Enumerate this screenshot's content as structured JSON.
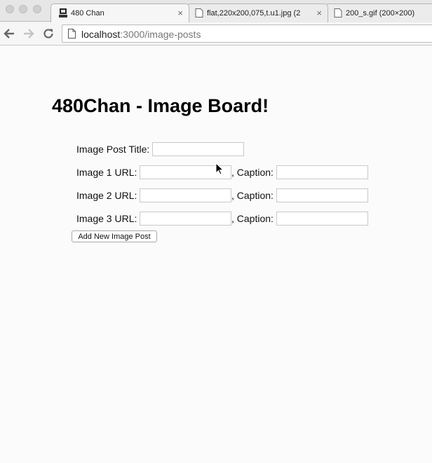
{
  "browser": {
    "tabs": [
      {
        "title": "480 Chan",
        "close": "×",
        "active": true
      },
      {
        "title": "flat,220x200,075,t.u1.jpg (2",
        "close": "×",
        "active": false
      },
      {
        "title": "200_s.gif (200×200)",
        "close": "",
        "active": false
      }
    ],
    "url_host": "localhost",
    "url_path": ":3000/image-posts"
  },
  "page": {
    "title": "480Chan - Image Board!",
    "form": {
      "post_title_label": "Image Post Title:",
      "image_rows": [
        {
          "url_label": "Image 1 URL:",
          "caption_label": ", Caption:"
        },
        {
          "url_label": "Image 2 URL:",
          "caption_label": ", Caption:"
        },
        {
          "url_label": "Image 3 URL:",
          "caption_label": ", Caption:"
        }
      ],
      "submit_label": "Add New Image Post"
    }
  },
  "icons": {
    "back": "arrow-left-icon",
    "forward": "arrow-right-icon",
    "reload": "reload-icon",
    "page": "page-icon"
  }
}
